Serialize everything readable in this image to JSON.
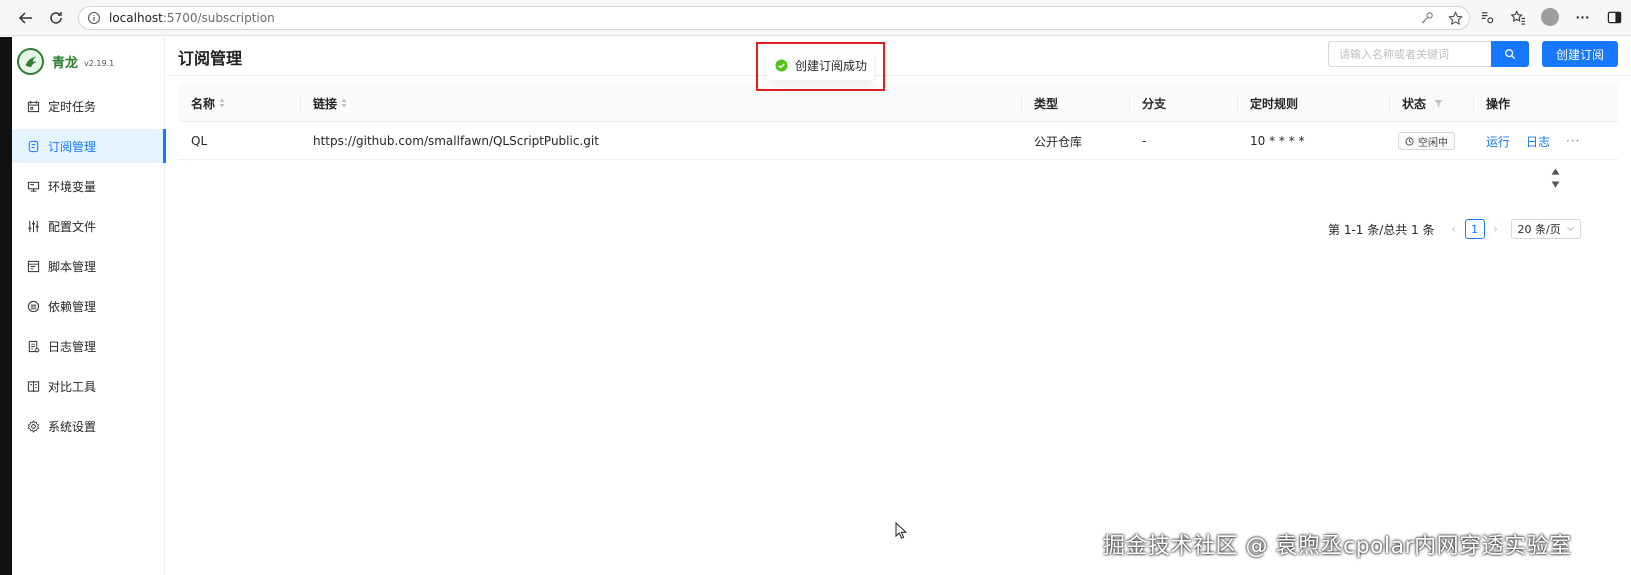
{
  "browser": {
    "url_host": "localhost",
    "url_path": ":5700/subscription"
  },
  "sidebar": {
    "brand_name": "青龙",
    "version": "v2.19.1",
    "items": [
      {
        "label": "定时任务",
        "icon": "calendar-icon",
        "active": false
      },
      {
        "label": "订阅管理",
        "icon": "subscribe-icon",
        "active": true
      },
      {
        "label": "环境变量",
        "icon": "monitor-icon",
        "active": false
      },
      {
        "label": "配置文件",
        "icon": "sliders-icon",
        "active": false
      },
      {
        "label": "脚本管理",
        "icon": "file-code-icon",
        "active": false
      },
      {
        "label": "依赖管理",
        "icon": "package-icon",
        "active": false
      },
      {
        "label": "日志管理",
        "icon": "log-icon",
        "active": false
      },
      {
        "label": "对比工具",
        "icon": "diff-icon",
        "active": false
      },
      {
        "label": "系统设置",
        "icon": "gear-icon",
        "active": false
      }
    ]
  },
  "header": {
    "title": "订阅管理",
    "search_placeholder": "请输入名称或者关键词",
    "create_label": "创建订阅"
  },
  "table": {
    "columns": [
      "名称",
      "链接",
      "类型",
      "分支",
      "定时规则",
      "状态",
      "操作"
    ],
    "rows": [
      {
        "name": "QL",
        "link": "https://github.com/smallfawn/QLScriptPublic.git",
        "type": "公开仓库",
        "branch": "-",
        "schedule": "10 * * * *",
        "status": "空闲中",
        "action_run": "运行",
        "action_log": "日志",
        "action_more": "···"
      }
    ]
  },
  "pagination": {
    "total_text": "第 1-1 条/总共 1 条",
    "current_page": "1",
    "page_size": "20 条/页"
  },
  "toast": {
    "message": "创建订阅成功"
  },
  "watermark": "掘金技术社区 @ 袁煦丞cpolar内网穿透实验室",
  "colors": {
    "primary": "#1677ff",
    "brand_green": "#2e7d32",
    "highlight_red": "#e02020",
    "success_green": "#52c41a"
  }
}
